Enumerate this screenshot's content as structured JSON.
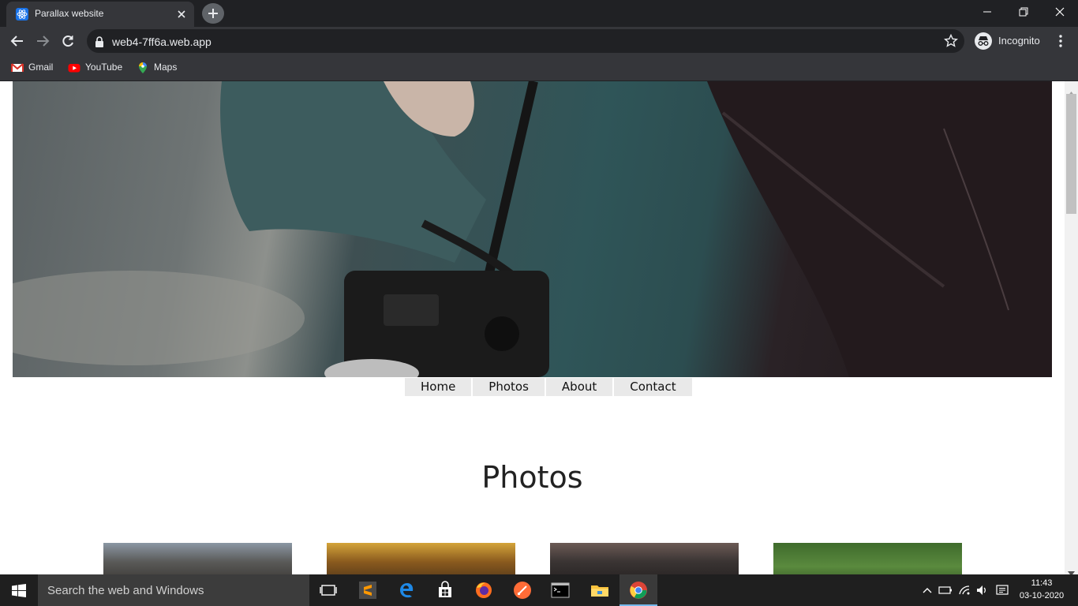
{
  "browser": {
    "tab": {
      "title": "Parallax website",
      "favicon": "react-icon",
      "close_icon": "close-icon"
    },
    "new_tab_icon": "plus-icon",
    "window_controls": [
      "minimize-icon",
      "restore-icon",
      "close-icon"
    ],
    "url": "web4-7ff6a.web.app",
    "mode_label": "Incognito",
    "bookmarks": [
      {
        "label": "Gmail",
        "icon": "gmail-icon"
      },
      {
        "label": "YouTube",
        "icon": "youtube-icon"
      },
      {
        "label": "Maps",
        "icon": "maps-icon"
      }
    ]
  },
  "page": {
    "nav": [
      "Home",
      "Photos",
      "About",
      "Contact"
    ],
    "section_title": "Photos",
    "hero_image": "photographer-with-camera-photo",
    "photos": [
      "rocks-photo",
      "sunset-photo",
      "camera-photo",
      "grass-photo"
    ]
  },
  "taskbar": {
    "search_placeholder": "Search the web and Windows",
    "apps": [
      "task-view-icon",
      "sublime-text-icon",
      "edge-icon",
      "store-icon",
      "firefox-icon",
      "postman-icon",
      "terminal-icon",
      "file-explorer-icon",
      "chrome-icon"
    ],
    "time": "11:43",
    "date": "03-10-2020"
  },
  "colors": {
    "tabbar": "#202124",
    "toolbar": "#35363a",
    "nav_bg": "#e9e9e9",
    "taskbar": "#1f1f1f"
  }
}
